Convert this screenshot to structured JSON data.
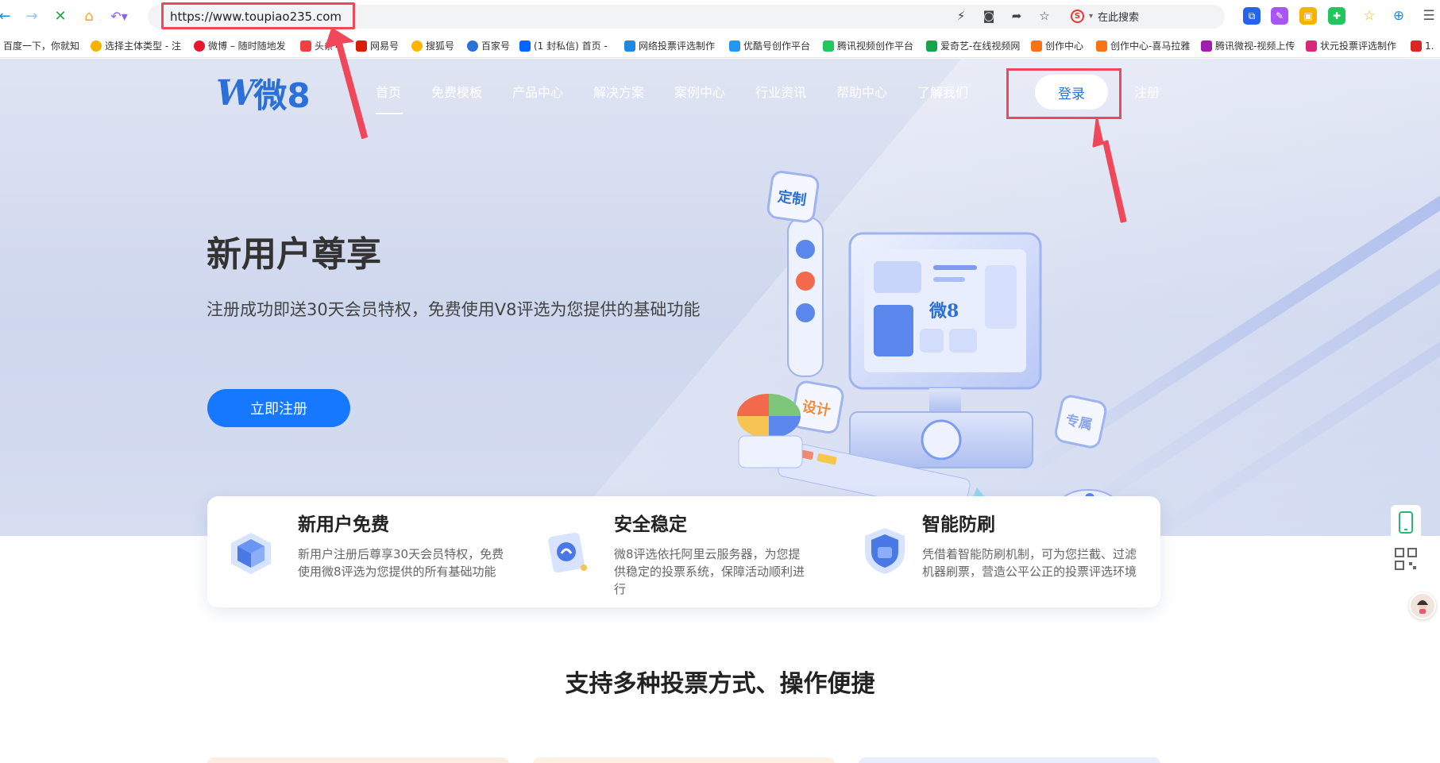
{
  "browser": {
    "url": "https://www.toupiao235.com",
    "search_label": "在此搜索",
    "search_engine_letter": "S"
  },
  "bookmarks": [
    {
      "label": "百度一下，你就知",
      "color": ""
    },
    {
      "label": "选择主体类型 - 注",
      "color": "#f5b301"
    },
    {
      "label": "微博 – 随时随地发",
      "color": "#e6162d"
    },
    {
      "label": "头条号",
      "color": "#f04142"
    },
    {
      "label": "网易号",
      "color": "#d81e06"
    },
    {
      "label": "搜狐号",
      "color": "#ffb400"
    },
    {
      "label": "百家号",
      "color": "#2b6fd8"
    },
    {
      "label": "(1 封私信) 首页 -",
      "color": "#0066ff"
    },
    {
      "label": "网络投票评选制作",
      "color": "#1e88e5"
    },
    {
      "label": "优酷号创作平台",
      "color": "#2196f3"
    },
    {
      "label": "腾讯视频创作平台",
      "color": "#22c55e"
    },
    {
      "label": "爱奇艺-在线视频网",
      "color": "#16a34a"
    },
    {
      "label": "创作中心",
      "color": "#f97316"
    },
    {
      "label": "创作中心-喜马拉雅",
      "color": "#f97316"
    },
    {
      "label": "腾讯微视-视频上传",
      "color": "#a21caf"
    },
    {
      "label": "状元投票评选制作",
      "color": "#db2777"
    },
    {
      "label": "1.",
      "color": "#dc2626"
    }
  ],
  "site": {
    "logo_name": "微8",
    "nav": [
      "首页",
      "免费模板",
      "产品中心",
      "解决方案",
      "案例中心",
      "行业资讯",
      "帮助中心",
      "了解我们"
    ],
    "login": "登录",
    "register": "注册"
  },
  "hero": {
    "title": "新用户尊享",
    "subtitle": "注册成功即送30天会员特权，免费使用V8评选为您提供的基础功能",
    "cta": "立即注册",
    "illustration_tags": [
      "定制",
      "设计",
      "专属"
    ],
    "screen_logo": "微8"
  },
  "features": [
    {
      "title": "新用户免费",
      "desc": "新用户注册后尊享30天会员特权，免费使用微8评选为您提供的所有基础功能"
    },
    {
      "title": "安全稳定",
      "desc": "微8评选依托阿里云服务器，为您提供稳定的投票系统，保障活动顺利进行"
    },
    {
      "title": "智能防刷",
      "desc": "凭借着智能防刷机制，可为您拦截、过滤机器刷票，营造公平公正的投票评选环境"
    }
  ],
  "section": {
    "title": "支持多种投票方式、操作便捷"
  },
  "colors": {
    "brand": "#1677ff",
    "annotation": "#f0475a"
  }
}
